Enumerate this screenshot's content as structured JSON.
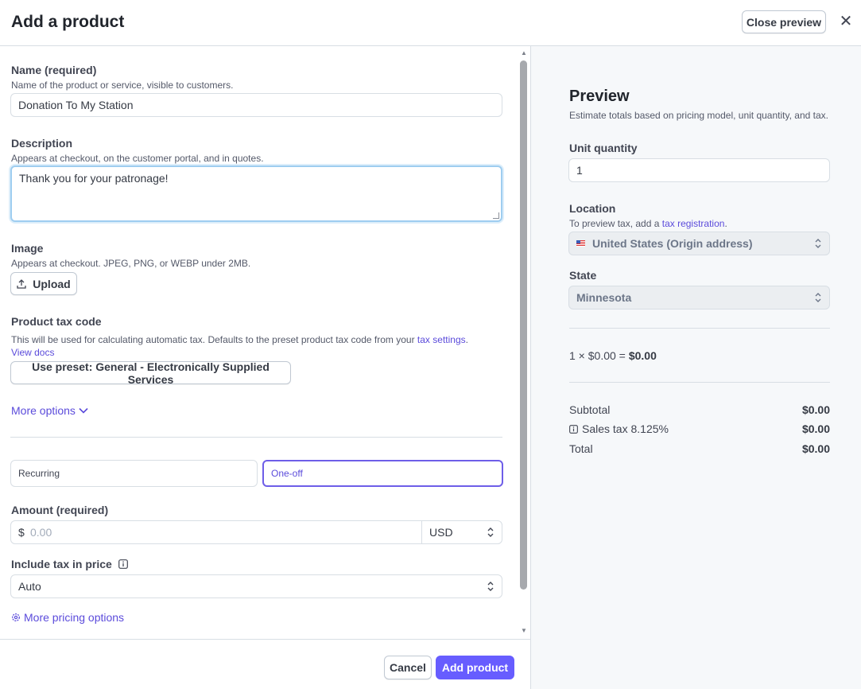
{
  "header": {
    "title": "Add a product",
    "close_preview_label": "Close preview",
    "close_glyph": "✕"
  },
  "form": {
    "name": {
      "label": "Name (required)",
      "help": "Name of the product or service, visible to customers.",
      "value": "Donation To My Station"
    },
    "description": {
      "label": "Description",
      "help": "Appears at checkout, on the customer portal, and in quotes.",
      "value": "Thank you for your patronage!"
    },
    "image": {
      "label": "Image",
      "help": "Appears at checkout. JPEG, PNG, or WEBP under 2MB.",
      "upload_label": "Upload",
      "upload_icon": "upload-icon"
    },
    "tax_code": {
      "label": "Product tax code",
      "help_prefix": "This will be used for calculating automatic tax. Defaults to the preset product tax code from your ",
      "help_link": "tax settings",
      "help_suffix": ".",
      "docs_link": "View docs",
      "preset_label": "Use preset: General - Electronically Supplied Services"
    },
    "more_options_label": "More options",
    "pricing_type": {
      "options": [
        "Recurring",
        "One-off"
      ],
      "selected": "One-off"
    },
    "amount": {
      "label": "Amount (required)",
      "currency_symbol": "$",
      "placeholder": "0.00",
      "currency": "USD"
    },
    "include_tax": {
      "label": "Include tax in price",
      "value": "Auto"
    },
    "more_pricing_label": "More pricing options"
  },
  "footer": {
    "cancel_label": "Cancel",
    "add_label": "Add product"
  },
  "preview": {
    "title": "Preview",
    "subtitle": "Estimate totals based on pricing model, unit quantity, and tax.",
    "unit_quantity": {
      "label": "Unit quantity",
      "value": "1"
    },
    "location": {
      "label": "Location",
      "help_prefix": "To preview tax, add a ",
      "help_link": "tax registration",
      "help_suffix": ".",
      "value": "United States (Origin address)"
    },
    "state": {
      "label": "State",
      "value": "Minnesota"
    },
    "calc": {
      "prefix": "1 × $0.00 = ",
      "result": "$0.00"
    },
    "subtotal": {
      "label": "Subtotal",
      "value": "$0.00"
    },
    "sales_tax": {
      "label": "Sales tax 8.125%",
      "value": "$0.00"
    },
    "total": {
      "label": "Total",
      "value": "$0.00"
    }
  },
  "colors": {
    "accent": "#675dff",
    "link": "#5b4bdb",
    "focus": "#9ecdf0"
  }
}
